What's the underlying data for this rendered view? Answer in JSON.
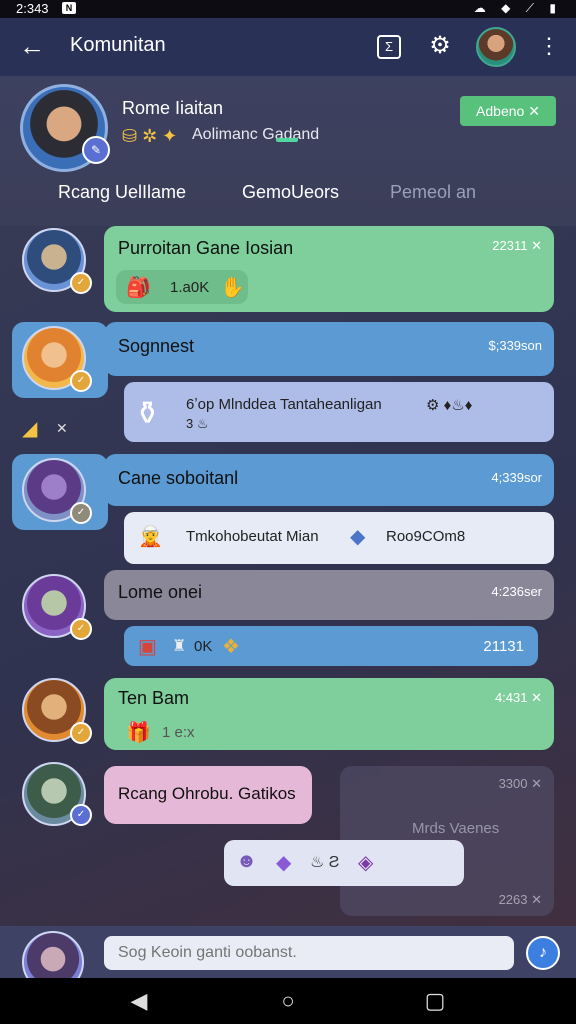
{
  "status": {
    "time": "2:343",
    "notif": "N"
  },
  "appbar": {
    "title": "Komunitan",
    "back_icon": "arrow-left-icon",
    "timer_glyph": "Σ"
  },
  "profile": {
    "name": "Rome Iiaitan",
    "subtitle": "Aolimanc Gadand",
    "icons": "⛁ ✲ ✦",
    "add_button": "Adbeno ✕"
  },
  "tabs": [
    "Rcang UelIlame",
    "GemoUeors",
    "Pemeol an"
  ],
  "messages": [
    {
      "name": "Purroitan Gane Iosian",
      "time": "22311 ✕",
      "chip": "1.a0K",
      "color": "#7ecf9b"
    },
    {
      "name": "Sognnest",
      "time": "$;339son",
      "chip": "6ʼop Mlnddea Tantaheanligan",
      "chip2": "3 ♨",
      "color": "#5b9ad2"
    },
    {
      "name": "Cane soboitanl",
      "time": "4;339sor",
      "chip": "Tmkohobeutat Mian",
      "chip2": "Roo9COm8",
      "color": "#5b9ad2"
    },
    {
      "name": "Lome onei",
      "time": "4:236ser",
      "chip": "0K",
      "chip_time": "21131",
      "color": "#8a8799"
    },
    {
      "name": "Ten Bam",
      "time": "4:431 ✕",
      "chip": "1 e:x",
      "color": "#7ecf9b"
    },
    {
      "name": "Rcang Ohrobu. Gatikos",
      "time": "3300 ✕",
      "aside": "Mrds Vaenes",
      "aside_time": "2263 ✕",
      "color": "#e6b8d8"
    }
  ],
  "composer": {
    "placeholder": "Sog Keoin ganti oobanst."
  },
  "colors": {
    "accent": "#54d6a0",
    "appbar": "#2a3157"
  }
}
